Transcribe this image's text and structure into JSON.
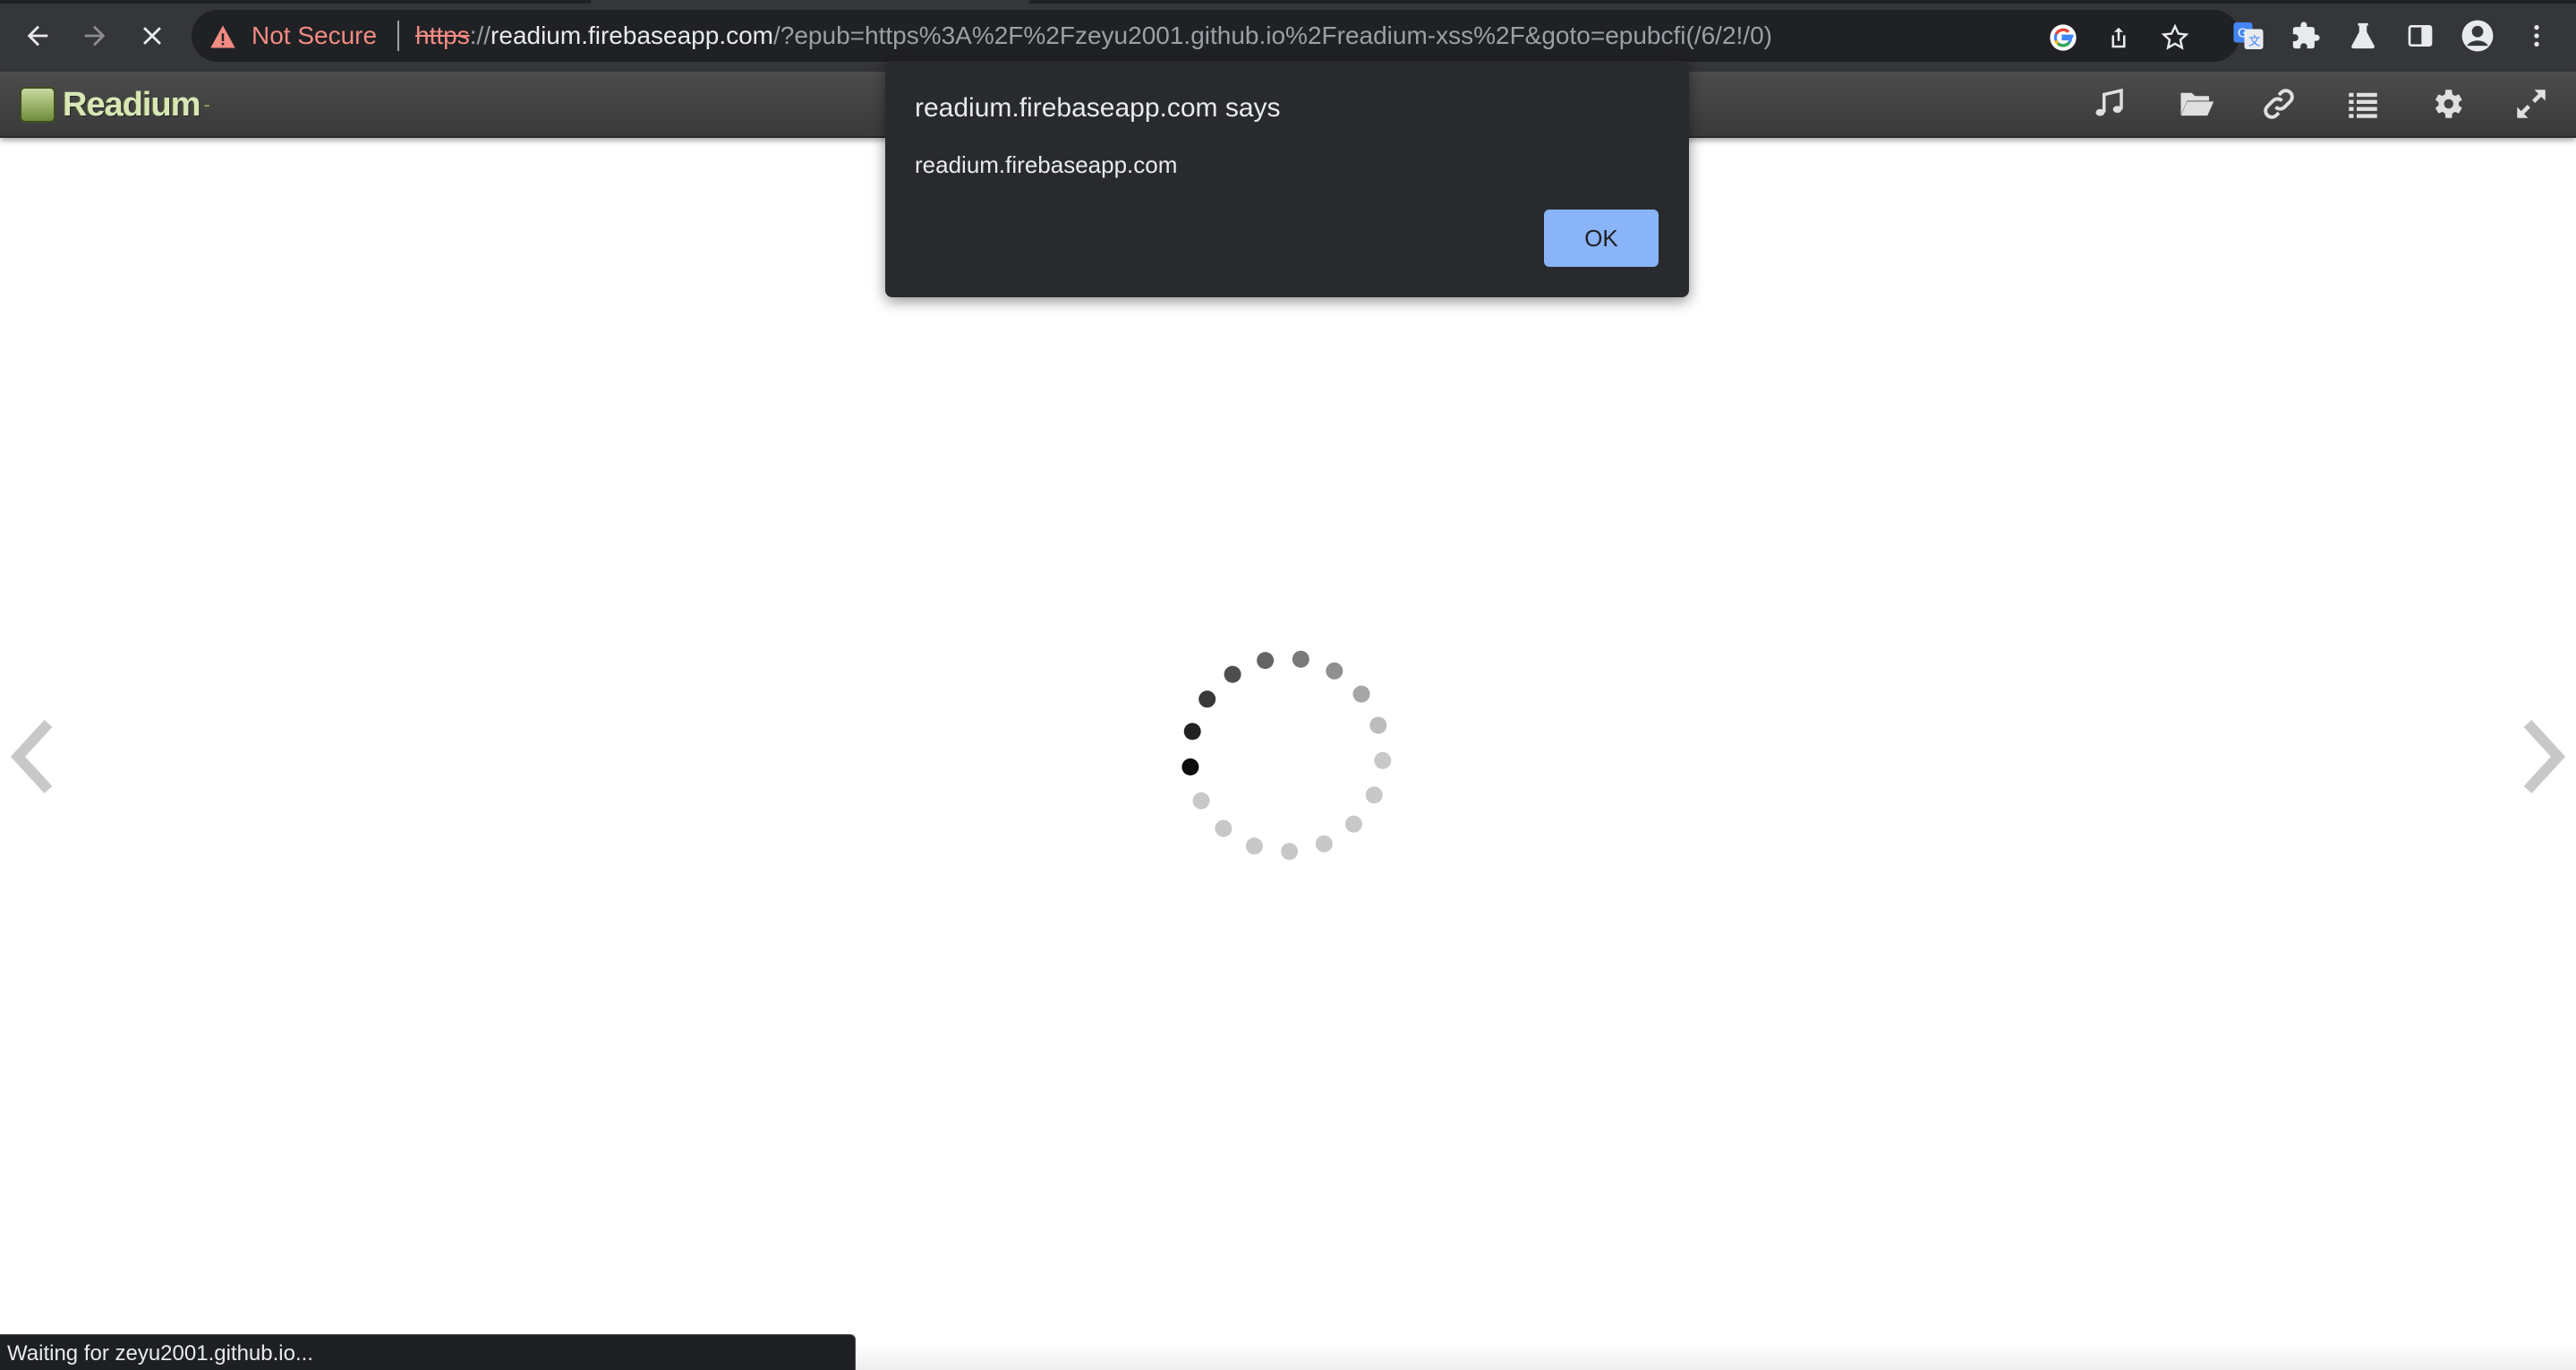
{
  "browser": {
    "omnibox": {
      "security_label": "Not Secure",
      "url_scheme": "https",
      "url_slashes": "://",
      "url_host": "readium.firebaseapp.com",
      "url_rest": "/?epub=https%3A%2F%2Fzeyu2001.github.io%2Freadium-xss%2F&goto=epubcfi(/6/2!/0)"
    },
    "nav": {
      "back": "back-arrow-icon",
      "forward": "forward-arrow-icon",
      "stop": "stop-loading-icon"
    },
    "status_text": "Waiting for zeyu2001.github.io..."
  },
  "reader": {
    "logo_text": "Readium",
    "toolbar_icons": [
      "audio-icon",
      "library-icon",
      "link-icon",
      "toc-icon",
      "settings-icon",
      "fullscreen-icon"
    ],
    "spinner_active_index": 0
  },
  "dialog": {
    "title": "readium.firebaseapp.com says",
    "message": "readium.firebaseapp.com",
    "ok_label": "OK",
    "accent": "#8ab4f8"
  }
}
